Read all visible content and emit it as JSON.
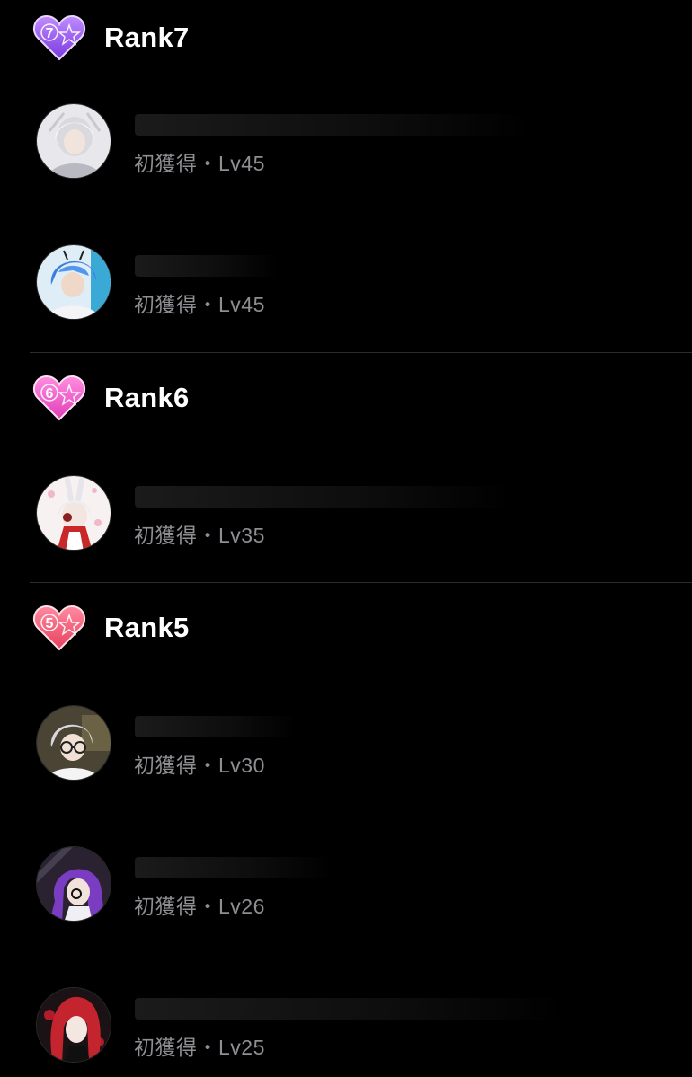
{
  "colors": {
    "background": "#000000",
    "text_primary": "#ffffff",
    "text_secondary": "#8e8e93",
    "divider": "#2c2c2e",
    "rank7_badge": "#9b59f0",
    "rank6_badge": "#f050c8",
    "rank5_badge": "#f0557a"
  },
  "ranks": [
    {
      "title": "Rank7",
      "badge_number": "7",
      "badge_icon": "purple-heart-rank-badge",
      "entries": [
        {
          "avatar": "silver-haired-character-avatar",
          "meta": "初獲得・Lv45"
        },
        {
          "avatar": "blue-haired-character-avatar",
          "meta": "初獲得・Lv45"
        }
      ]
    },
    {
      "title": "Rank6",
      "badge_number": "6",
      "badge_icon": "pink-heart-rank-badge",
      "entries": [
        {
          "avatar": "white-rabbit-character-avatar",
          "meta": "初獲得・Lv35"
        }
      ]
    },
    {
      "title": "Rank5",
      "badge_number": "5",
      "badge_icon": "red-heart-rank-badge",
      "entries": [
        {
          "avatar": "glasses-character-avatar",
          "meta": "初獲得・Lv30"
        },
        {
          "avatar": "purple-haired-character-avatar",
          "meta": "初獲得・Lv26"
        },
        {
          "avatar": "red-haired-character-avatar",
          "meta": "初獲得・Lv25"
        }
      ]
    }
  ]
}
